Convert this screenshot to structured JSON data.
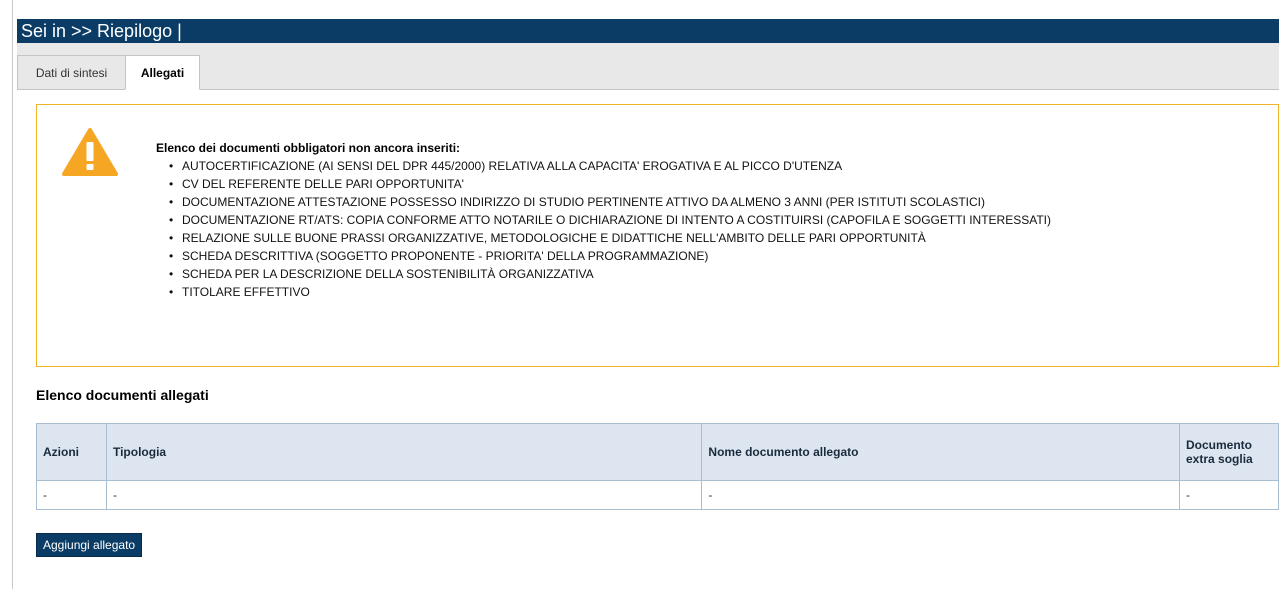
{
  "breadcrumb": {
    "text": "Sei in >> Riepilogo |"
  },
  "tabs": [
    {
      "label": "Dati di sintesi",
      "active": false
    },
    {
      "label": "Allegati",
      "active": true
    }
  ],
  "alert": {
    "icon": "warning-triangle-icon",
    "icon_color": "#f5a623",
    "border_color": "#f0b429",
    "heading": "Elenco dei documenti obbligatori non ancora inseriti:",
    "items": [
      "AUTOCERTIFICAZIONE (AI SENSI DEL DPR 445/2000) RELATIVA ALLA CAPACITA' EROGATIVA E AL PICCO D'UTENZA",
      "CV DEL REFERENTE DELLE PARI OPPORTUNITA'",
      "DOCUMENTAZIONE ATTESTAZIONE POSSESSO INDIRIZZO DI STUDIO PERTINENTE ATTIVO DA ALMENO 3 ANNI (PER ISTITUTI SCOLASTICI)",
      "DOCUMENTAZIONE RT/ATS: COPIA CONFORME ATTO NOTARILE O DICHIARAZIONE DI INTENTO A COSTITUIRSI (CAPOFILA E SOGGETTI INTERESSATI)",
      "RELAZIONE SULLE BUONE PRASSI ORGANIZZATIVE, METODOLOGICHE E DIDATTICHE NELL'AMBITO DELLE PARI OPPORTUNITÀ",
      "SCHEDA DESCRITTIVA (SOGGETTO PROPONENTE - PRIORITA' DELLA PROGRAMMAZIONE)",
      "SCHEDA PER LA DESCRIZIONE DELLA SOSTENIBILITÀ ORGANIZZATIVA",
      "TITOLARE EFFETTIVO"
    ]
  },
  "attachments": {
    "title": "Elenco documenti allegati",
    "columns": [
      "Azioni",
      "Tipologia",
      "Nome documento allegato",
      "Documento extra soglia"
    ],
    "rows": [
      [
        "-",
        "-",
        "-",
        "-"
      ]
    ]
  },
  "add_button": {
    "label": "Aggiungi allegato"
  },
  "colors": {
    "header_bg": "#0b3c66",
    "table_header_bg": "#dde6f0",
    "button_bg": "#0b3c66"
  }
}
